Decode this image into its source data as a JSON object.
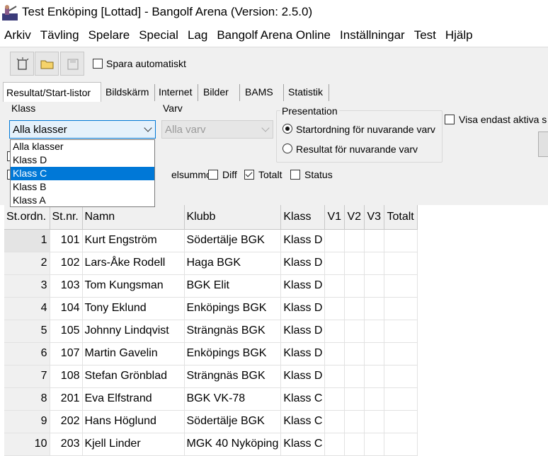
{
  "window": {
    "title": "Test Enköping [Lottad] - Bangolf Arena (Version: 2.5.0)",
    "icon": "golfer-app-icon"
  },
  "menu": [
    "Arkiv",
    "Tävling",
    "Spelare",
    "Special",
    "Lag",
    "Bangolf Arena Online",
    "Inställningar",
    "Test",
    "Hjälp"
  ],
  "toolbar": {
    "new_icon": "new-document-icon",
    "open_icon": "open-folder-icon",
    "save_icon": "save-disk-icon",
    "autosave_label": "Spara automatiskt",
    "autosave_checked": false
  },
  "tabs": [
    "Resultat/Start-listor",
    "Bildskärm",
    "Internet",
    "Bilder",
    "BAMS",
    "Statistik"
  ],
  "filters": {
    "klass_label": "Klass",
    "klass_value": "Alla klasser",
    "varv_label": "Varv",
    "varv_value": "Alla varv",
    "presentation_label": "Presentation",
    "radio_start": "Startordning för nuvarande varv",
    "radio_result": "Resultat för nuvarande varv",
    "visa_label": "Visa endast aktiva s",
    "delsummor_label": "elsummor",
    "diff_label": "Diff",
    "totalt_label": "Totalt",
    "status_label": "Status"
  },
  "dropdown": {
    "options": [
      "Alla klasser",
      "Klass D",
      "Klass C",
      "Klass B",
      "Klass A"
    ],
    "highlighted_index": 2
  },
  "table": {
    "columns": [
      "St.ordn.",
      "St.nr.",
      "Namn",
      "Klubb",
      "Klass",
      "V1",
      "V2",
      "V3",
      "Totalt"
    ],
    "rows": [
      [
        "1",
        "101",
        "Kurt Engström",
        "Södertälje BGK",
        "Klass D"
      ],
      [
        "2",
        "102",
        "Lars-Åke Rodell",
        "Haga BGK",
        "Klass D"
      ],
      [
        "3",
        "103",
        "Tom Kungsman",
        "BGK Elit",
        "Klass D"
      ],
      [
        "4",
        "104",
        "Tony Eklund",
        "Enköpings BGK",
        "Klass D"
      ],
      [
        "5",
        "105",
        "Johnny Lindqvist",
        "Strängnäs BGK",
        "Klass D"
      ],
      [
        "6",
        "107",
        "Martin Gavelin",
        "Enköpings BGK",
        "Klass D"
      ],
      [
        "7",
        "108",
        "Stefan Grönblad",
        "Strängnäs BGK",
        "Klass D"
      ],
      [
        "8",
        "201",
        "Eva Elfstrand",
        "BGK VK-78",
        "Klass C"
      ],
      [
        "9",
        "202",
        "Hans Höglund",
        "Södertälje BGK",
        "Klass C"
      ],
      [
        "10",
        "203",
        "Kjell Linder",
        "MGK 40 Nyköping",
        "Klass C"
      ]
    ]
  },
  "colors": {
    "selection": "#0078d7",
    "panel": "#f0f0f0"
  }
}
